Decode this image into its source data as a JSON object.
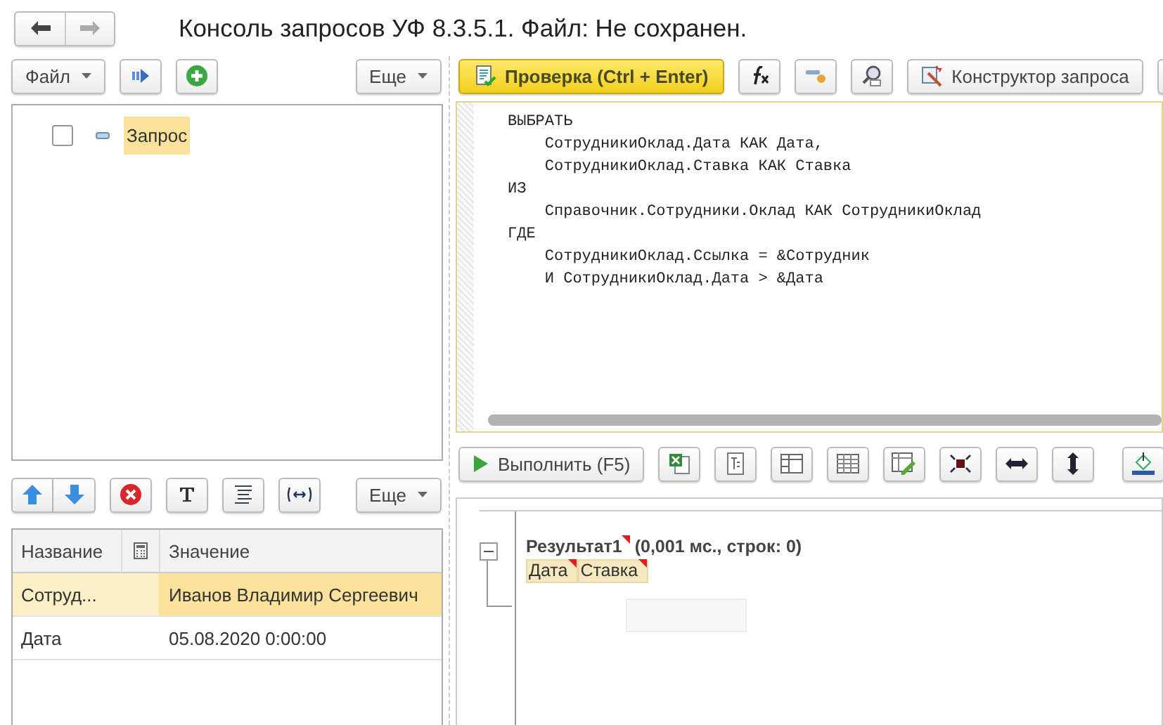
{
  "window": {
    "title": "Консоль запросов УФ 8.3.5.1. Файл: Не сохранен."
  },
  "left_toolbar": {
    "file_menu": "Файл",
    "more_menu": "Еще"
  },
  "query_tree": [
    {
      "label": "Запрос",
      "checked": false,
      "expanded": true,
      "selected": true
    }
  ],
  "params_toolbar": {
    "more_menu": "Еще"
  },
  "params_table": {
    "columns": [
      "Название",
      "Значение"
    ],
    "rows": [
      {
        "name": "Сотруд...",
        "value": "Иванов Владимир Сергеевич",
        "selected": true
      },
      {
        "name": "Дата",
        "value": "05.08.2020 0:00:00",
        "selected": false
      }
    ]
  },
  "editor_toolbar": {
    "check_button": "Проверка (Ctrl + Enter)",
    "designer_button": "Конструктор запроса"
  },
  "query_text": [
    "ВЫБРАТЬ",
    "    СотрудникиОклад.Дата КАК Дата,",
    "    СотрудникиОклад.Ставка КАК Ставка",
    "ИЗ",
    "    Справочник.Сотрудники.Оклад КАК СотрудникиОклад",
    "ГДЕ",
    "    СотрудникиОклад.Ссылка = &Сотрудник",
    "    И СотрудникиОклад.Дата > &Дата"
  ],
  "result_toolbar": {
    "run_button": "Выполнить (F5)"
  },
  "result": {
    "title": "Результат1",
    "summary": "(0,001 мс., строк: 0)",
    "expanded": true,
    "columns": [
      "Дата",
      "Ставка"
    ]
  }
}
